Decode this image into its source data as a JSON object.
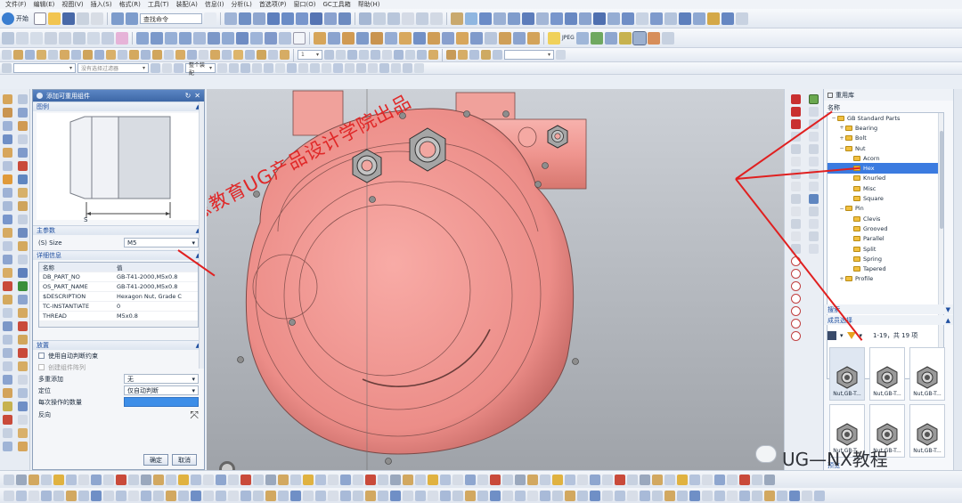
{
  "menu": [
    "文件(F)",
    "编辑(E)",
    "视图(V)",
    "插入(S)",
    "格式(R)",
    "工具(T)",
    "装配(A)",
    "信息(I)",
    "分析(L)",
    "首选项(P)",
    "窗口(O)",
    "GC工具箱",
    "帮助(H)"
  ],
  "toolbar": {
    "start_label": "开始",
    "command_finder_placeholder": "查找命令",
    "count_field": "1",
    "filter_combo": "没有选择过滤器",
    "scope_combo": "整个装配",
    "jpeg_label": "JPEG"
  },
  "dialog": {
    "title": "添加可重用组件",
    "sections": {
      "preview": "图例",
      "main_params": "主参数",
      "details": "详细信息",
      "placement": "放置"
    },
    "preview_dim_label": "S",
    "size_label": "(S) Size",
    "size_value": "M5",
    "details_headers": [
      "名称",
      "值"
    ],
    "details_rows": [
      {
        "name": "DB_PART_NO",
        "value": "GB-T41-2000,M5x0.8"
      },
      {
        "name": "OS_PART_NAME",
        "value": "GB-T41-2000,M5x0.8"
      },
      {
        "name": "$DESCRIPTION",
        "value": "Hexagon Nut, Grade C"
      },
      {
        "name": "TC-INSTANTIATE",
        "value": "0"
      },
      {
        "name": "THREAD",
        "value": "M5x0.8"
      }
    ],
    "placement": {
      "auto_constraint": "使用自动判断约束",
      "create_array": "创建组件阵列",
      "multiple_add_label": "多重添加",
      "multiple_add_value": "无",
      "location_label": "定位",
      "location_value": "仅自动判断",
      "count_label": "每次操作的数量",
      "reverse_label": "反向"
    },
    "ok_label": "确定",
    "cancel_label": "取消"
  },
  "library": {
    "title": "重用库",
    "name_header": "名称",
    "tree": [
      {
        "label": "GB Standard Parts",
        "depth": 0,
        "expanded": true
      },
      {
        "label": "Bearing",
        "depth": 1,
        "expanded": false
      },
      {
        "label": "Bolt",
        "depth": 1,
        "expanded": false
      },
      {
        "label": "Nut",
        "depth": 1,
        "expanded": true
      },
      {
        "label": "Acorn",
        "depth": 2
      },
      {
        "label": "Hex",
        "depth": 2,
        "selected": true
      },
      {
        "label": "Knurled",
        "depth": 2
      },
      {
        "label": "Misc",
        "depth": 2
      },
      {
        "label": "Square",
        "depth": 2
      },
      {
        "label": "Pin",
        "depth": 1,
        "expanded": true
      },
      {
        "label": "Clevis",
        "depth": 2
      },
      {
        "label": "Grooved",
        "depth": 2
      },
      {
        "label": "Parallel",
        "depth": 2
      },
      {
        "label": "Split",
        "depth": 2
      },
      {
        "label": "Spring",
        "depth": 2
      },
      {
        "label": "Tapered",
        "depth": 2
      },
      {
        "label": "Profile",
        "depth": 1,
        "expanded": false
      }
    ],
    "search_label": "搜索",
    "member_select_label": "成员选择",
    "paging": "1-19，共 19 项",
    "members": [
      "Nut,GB-T...",
      "Nut,GB-T...",
      "Nut,GB-T...",
      "Nut,GB-T...",
      "Nut,GB-T...",
      "Nut,GB-T..."
    ],
    "preview_label": "预览"
  },
  "watermarks": {
    "center": "吾思教育UG产品设计学院出品",
    "bottom_right": "UG—NX教程"
  },
  "colors": {
    "part_body": "#f1938f",
    "selection": "#3b7be0",
    "title_bar": "#3d67a6",
    "annotation": "#e02020"
  }
}
